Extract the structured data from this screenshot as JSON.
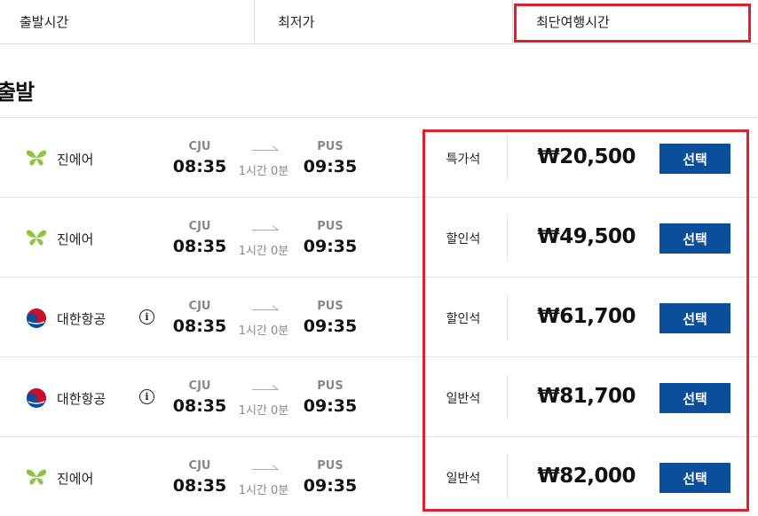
{
  "tabs": [
    {
      "label": "출발시간"
    },
    {
      "label": "최저가"
    },
    {
      "label": "최단여행시간"
    }
  ],
  "section_title": "출발",
  "colors": {
    "select_button": "#0b4f9c",
    "highlight": "#e0202a",
    "jinair_logo": "#8cc63f",
    "koreanair_red": "#c8102e",
    "koreanair_blue": "#0a4b9a"
  },
  "flights": [
    {
      "airline": "진에어",
      "logo": "jinair-butterfly-logo",
      "info": false,
      "dep_code": "CJU",
      "dep_time": "08:35",
      "duration": "1시간 0분",
      "arr_code": "PUS",
      "arr_time": "09:35",
      "cabin": "특가석",
      "price": "₩20,500",
      "button": "선택"
    },
    {
      "airline": "진에어",
      "logo": "jinair-butterfly-logo",
      "info": false,
      "dep_code": "CJU",
      "dep_time": "08:35",
      "duration": "1시간 0분",
      "arr_code": "PUS",
      "arr_time": "09:35",
      "cabin": "할인석",
      "price": "₩49,500",
      "button": "선택"
    },
    {
      "airline": "대한항공",
      "logo": "koreanair-taeguk-logo",
      "info": true,
      "info_symbol": "i",
      "dep_code": "CJU",
      "dep_time": "08:35",
      "duration": "1시간 0분",
      "arr_code": "PUS",
      "arr_time": "09:35",
      "cabin": "할인석",
      "price": "₩61,700",
      "button": "선택"
    },
    {
      "airline": "대한항공",
      "logo": "koreanair-taeguk-logo",
      "info": true,
      "info_symbol": "i",
      "dep_code": "CJU",
      "dep_time": "08:35",
      "duration": "1시간 0분",
      "arr_code": "PUS",
      "arr_time": "09:35",
      "cabin": "일반석",
      "price": "₩81,700",
      "button": "선택"
    },
    {
      "airline": "진에어",
      "logo": "jinair-butterfly-logo",
      "info": false,
      "dep_code": "CJU",
      "dep_time": "08:35",
      "duration": "1시간 0분",
      "arr_code": "PUS",
      "arr_time": "09:35",
      "cabin": "일반석",
      "price": "₩82,000",
      "button": "선택"
    }
  ]
}
